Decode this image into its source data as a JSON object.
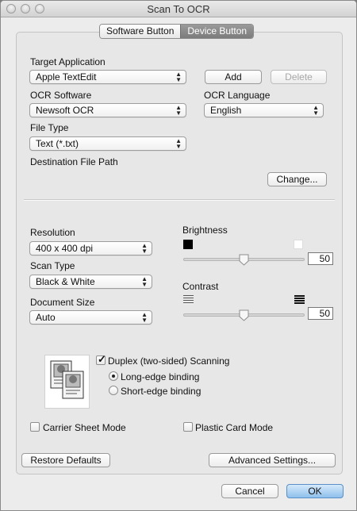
{
  "window": {
    "title": "Scan To OCR"
  },
  "tabs": [
    {
      "label": "Software Button",
      "active": false
    },
    {
      "label": "Device Button",
      "active": true
    }
  ],
  "target_application": {
    "label": "Target Application",
    "value": "Apple TextEdit",
    "add_label": "Add",
    "delete_label": "Delete"
  },
  "ocr_software": {
    "label": "OCR Software",
    "value": "Newsoft OCR"
  },
  "ocr_language": {
    "label": "OCR Language",
    "value": "English"
  },
  "file_type": {
    "label": "File Type",
    "value": "Text (*.txt)"
  },
  "destination": {
    "label": "Destination File Path",
    "change_label": "Change..."
  },
  "resolution": {
    "label": "Resolution",
    "value": "400 x 400 dpi"
  },
  "scan_type": {
    "label": "Scan Type",
    "value": "Black & White"
  },
  "document_size": {
    "label": "Document Size",
    "value": "Auto"
  },
  "brightness": {
    "label": "Brightness",
    "value": "50",
    "level": 0.5
  },
  "contrast": {
    "label": "Contrast",
    "value": "50",
    "level": 0.5
  },
  "duplex": {
    "label": "Duplex (two-sided) Scanning",
    "checked": true,
    "long_edge": "Long-edge binding",
    "short_edge": "Short-edge binding",
    "selected": "long_edge"
  },
  "carrier_sheet": {
    "label": "Carrier Sheet Mode",
    "checked": false
  },
  "plastic_card": {
    "label": "Plastic Card Mode",
    "checked": false
  },
  "footer": {
    "restore_label": "Restore Defaults",
    "advanced_label": "Advanced Settings...",
    "cancel_label": "Cancel",
    "ok_label": "OK"
  },
  "colors": {
    "accent": "#8fc0ec",
    "active_tab": "#8a8a8a"
  }
}
